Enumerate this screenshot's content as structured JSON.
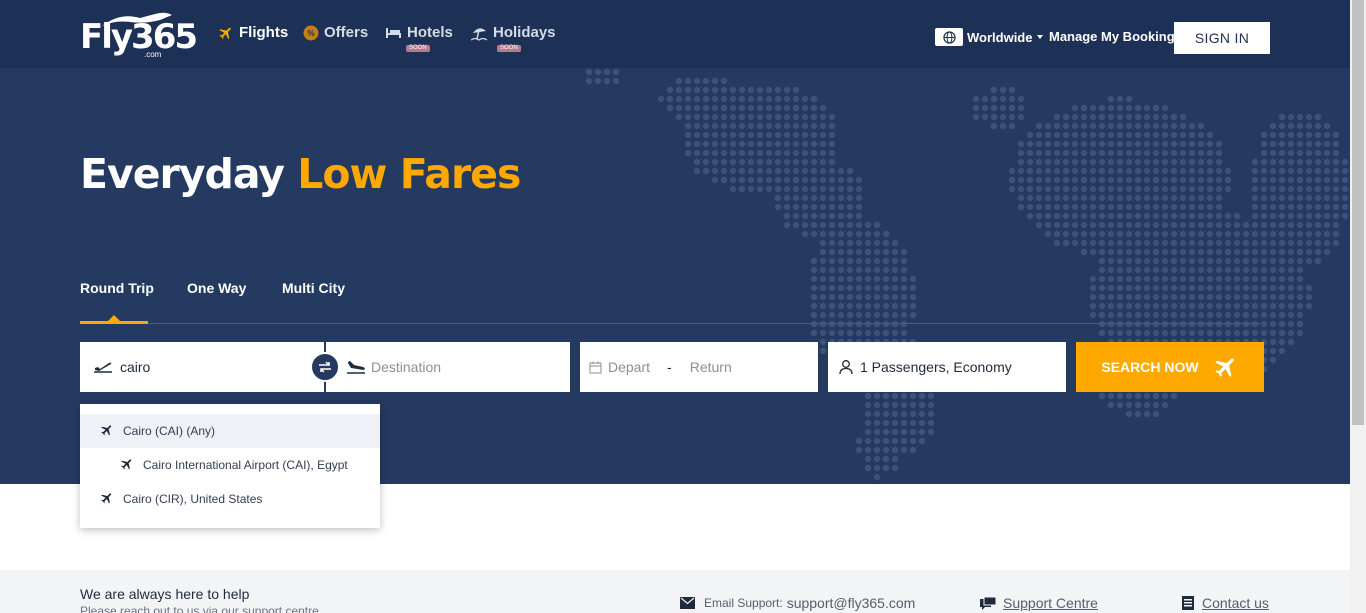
{
  "header": {
    "logo_text": "Fly365",
    "logo_sub": ".com",
    "nav": [
      {
        "label": "Flights",
        "icon": "plane-icon",
        "active": true
      },
      {
        "label": "Offers",
        "icon": "percent-badge-icon",
        "active": false
      },
      {
        "label": "Hotels",
        "icon": "bed-icon",
        "active": false,
        "badge": "SOON"
      },
      {
        "label": "Holidays",
        "icon": "beach-umbrella-icon",
        "active": false,
        "badge": "SOON"
      }
    ],
    "region": "Worldwide",
    "manage_booking": "Manage My Booking",
    "sign_in": "SIGN IN"
  },
  "hero": {
    "headline_part1": "Everyday",
    "headline_part2": "Low Fares",
    "tabs": [
      "Round Trip",
      "One Way",
      "Multi City"
    ],
    "origin_value": "cairo",
    "destination_placeholder": "Destination",
    "depart_label": "Depart",
    "date_separator": "-",
    "return_label": "Return",
    "passengers": "1 Passengers, Economy",
    "search_button": "SEARCH NOW"
  },
  "dropdown": [
    "Cairo (CAI) (Any)",
    "Cairo International Airport (CAI), Egypt",
    "Cairo (CIR), United States"
  ],
  "footer": {
    "help_title": "We are always here to help",
    "help_sub": "Please reach out to us via our support centre",
    "email_label": "Email Support:",
    "email_value": "support@fly365.com",
    "support_centre": "Support Centre",
    "contact_us": "Contact us"
  },
  "colors": {
    "navy": "#1d3056",
    "hero_bg": "#243a61",
    "accent": "#ffa800"
  }
}
